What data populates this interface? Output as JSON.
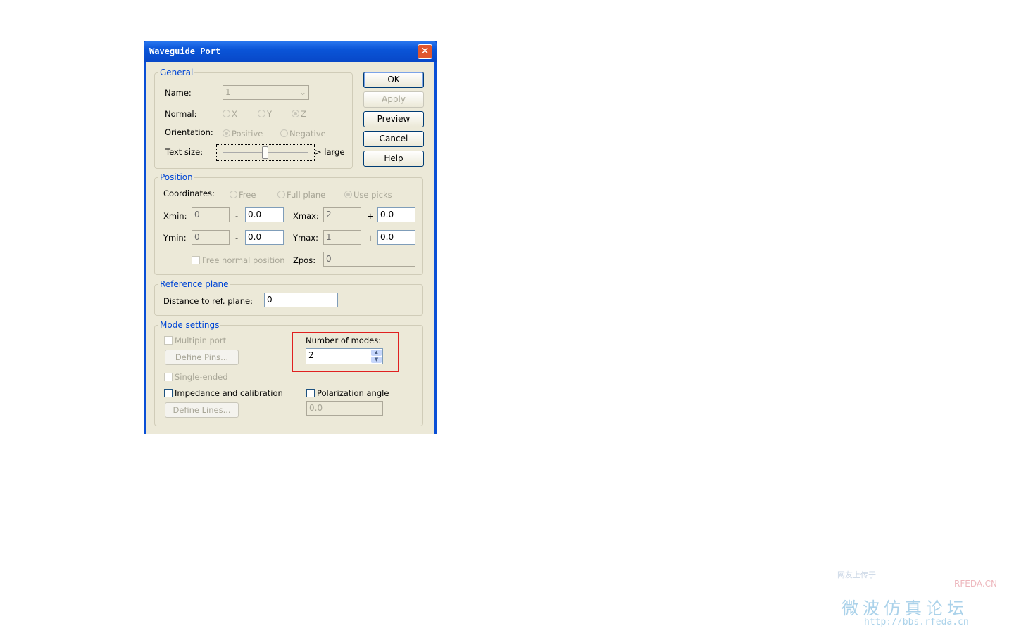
{
  "dialog": {
    "title": "Waveguide Port"
  },
  "buttons": {
    "ok": "OK",
    "apply": "Apply",
    "preview": "Preview",
    "cancel": "Cancel",
    "help": "Help"
  },
  "general": {
    "label": "General",
    "name_label": "Name:",
    "name_value": "1",
    "normal_label": "Normal:",
    "normal_options": [
      "X",
      "Y",
      "Z"
    ],
    "normal_selected": "Z",
    "orientation_label": "Orientation:",
    "orientation_options": [
      "Positive",
      "Negative"
    ],
    "orientation_selected": "Positive",
    "text_size_label": "Text size:",
    "text_size_suffix": "> large",
    "text_size_value": 0.5
  },
  "position": {
    "label": "Position",
    "coordinates_label": "Coordinates:",
    "coordinate_options": [
      "Free",
      "Full plane",
      "Use picks"
    ],
    "coordinate_selected": "Use picks",
    "xmin_label": "Xmin:",
    "xmin": "0",
    "xmin_offset": "0.0",
    "xmax_label": "Xmax:",
    "xmax": "2",
    "xmax_offset": "0.0",
    "ymin_label": "Ymin:",
    "ymin": "0",
    "ymin_offset": "0.0",
    "ymax_label": "Ymax:",
    "ymax": "1",
    "ymax_offset": "0.0",
    "minus": "-",
    "plus": "+",
    "free_normal_label": "Free normal position",
    "zpos_label": "Zpos:",
    "zpos": "0"
  },
  "reference": {
    "label": "Reference plane",
    "distance_label": "Distance to ref. plane:",
    "distance": "0"
  },
  "mode": {
    "label": "Mode settings",
    "multipin": "Multipin port",
    "define_pins": "Define Pins...",
    "single_ended": "Single-ended",
    "impedance": "Impedance and calibration",
    "define_lines": "Define Lines...",
    "num_modes_label": "Number of modes:",
    "num_modes": "2",
    "polarization": "Polarization angle",
    "polarization_value": "0.0"
  },
  "watermark": {
    "line1": "网友上传于",
    "brand": "RFEDA.CN",
    "name": "微波仿真论坛",
    "url": "http://bbs.rfeda.cn"
  }
}
